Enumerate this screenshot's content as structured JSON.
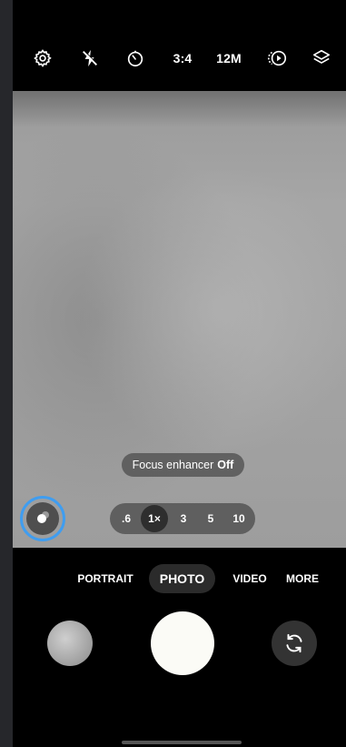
{
  "top_bar": {
    "icons": [
      "settings-gear-icon",
      "flash-off-icon",
      "timer-icon",
      "motion-photo-icon",
      "layers-filter-icon"
    ],
    "aspect_ratio": "3:4",
    "resolution": "12M"
  },
  "viewfinder": {
    "focus_enhancer_label": "Focus enhancer",
    "focus_enhancer_state": "Off"
  },
  "zoom": {
    "options": [
      ".6",
      "1×",
      "3",
      "5",
      "10"
    ],
    "selected": "1×"
  },
  "modes": {
    "items": [
      "PORTRAIT",
      "PHOTO",
      "VIDEO",
      "MORE"
    ],
    "selected": "PHOTO"
  },
  "colors": {
    "accent_ring": "#3f9df0",
    "shutter": "#fbfbf6",
    "background": "#000000"
  }
}
